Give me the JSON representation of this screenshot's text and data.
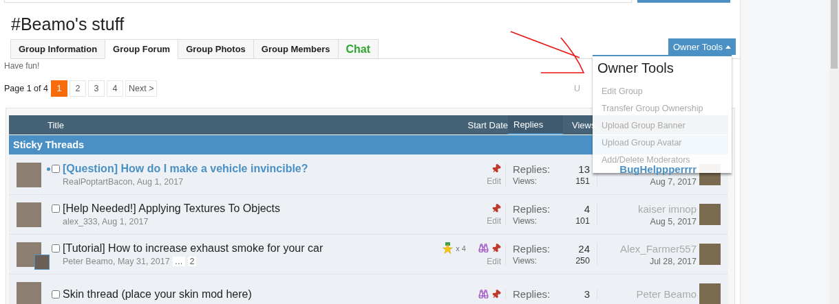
{
  "group": {
    "title": "#Beamo's stuff",
    "description": "Have fun!"
  },
  "tabs": [
    {
      "label": "Group Information",
      "selected": false,
      "kind": "normal"
    },
    {
      "label": "Group Forum",
      "selected": true,
      "kind": "normal"
    },
    {
      "label": "Group Photos",
      "selected": false,
      "kind": "normal"
    },
    {
      "label": "Group Members",
      "selected": false,
      "kind": "normal"
    },
    {
      "label": "Chat",
      "selected": false,
      "kind": "chat"
    }
  ],
  "owner_tools": {
    "button": "Owner Tools",
    "expanded": true,
    "menu_title": "Owner Tools",
    "items": [
      "Edit Group",
      "Transfer Group Ownership",
      "Upload Group Banner",
      "Upload Group Avatar",
      "Add/Delete Moderators"
    ]
  },
  "pagination": {
    "label": "Page 1 of 4",
    "pages": [
      {
        "label": "1",
        "selected": true
      },
      {
        "label": "2",
        "selected": false
      },
      {
        "label": "3",
        "selected": false
      },
      {
        "label": "4",
        "selected": false
      }
    ],
    "next": "Next >"
  },
  "forum_link": "U",
  "table": {
    "columns": [
      {
        "label": "Title",
        "selected": false
      },
      {
        "label": "Start Date",
        "selected": false
      },
      {
        "label": "Replies",
        "selected": true
      },
      {
        "label": "Views",
        "selected": false
      }
    ],
    "section": "Sticky Threads",
    "rows": [
      {
        "title": "[Question] How do I make a vehicle invincible?",
        "checked": false,
        "unread": true,
        "byline": "RealPoptartBacon, Aug 1, 2017",
        "participant_avatar": false,
        "pages": [],
        "watched": false,
        "sticky": true,
        "edit": "Edit",
        "replies_label": "Replies:",
        "replies": "13",
        "views_label": "Views:",
        "views": "151",
        "last_poster": "BugHelppperrrr",
        "last_date": "Aug 7, 2017"
      },
      {
        "title": "[Help Needed!] Applying Textures To Objects",
        "checked": false,
        "unread": false,
        "byline": "alex_333, Aug 1, 2017",
        "participant_avatar": false,
        "pages": [],
        "watched": false,
        "sticky": true,
        "edit": "Edit",
        "replies_label": "Replies:",
        "replies": "4",
        "views_label": "Views:",
        "views": "101",
        "last_poster": "kaiser imnop",
        "last_date": "Aug 5, 2017"
      },
      {
        "title": "[Tutorial] How to increase exhaust smoke for your car",
        "checked": false,
        "unread": false,
        "byline": "Peter Beamo, May 31, 2017",
        "participant_avatar": true,
        "pages": [
          "…",
          "2"
        ],
        "medal": "x 4",
        "watched": true,
        "sticky": true,
        "edit": "Edit",
        "replies_label": "Replies:",
        "replies": "24",
        "views_label": "Views:",
        "views": "250",
        "last_poster": "Alex_Farmer557",
        "last_date": "Jul 28, 2017"
      },
      {
        "title": "Skin thread (place your skin mod here)",
        "checked": false,
        "unread": false,
        "participant_avatar": false,
        "pages": [],
        "watched": true,
        "sticky": true,
        "replies_label": "Replies:",
        "replies": "3",
        "last_poster": "Peter Beamo"
      }
    ]
  }
}
